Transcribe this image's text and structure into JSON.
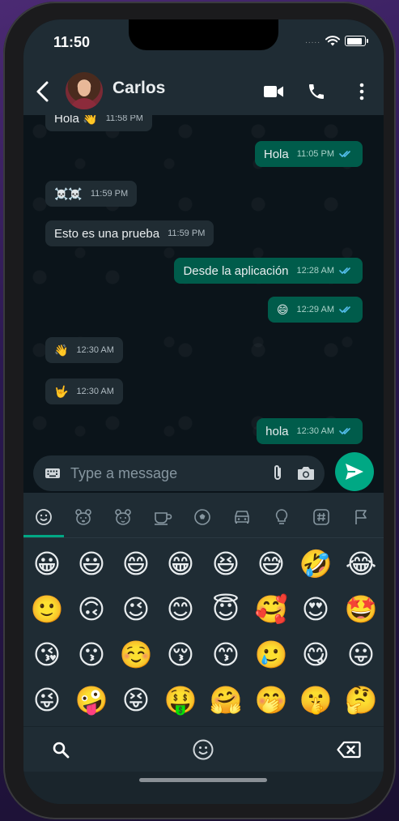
{
  "status_bar": {
    "time": "11:50",
    "signal_dots": "....."
  },
  "header": {
    "contact_name": "Carlos"
  },
  "messages": [
    {
      "dir": "in",
      "text": "Hola 👋",
      "time": "11:58 PM"
    },
    {
      "dir": "out",
      "text": "Hola",
      "time": "11:05 PM",
      "read": true
    },
    {
      "dir": "in",
      "text": "☠️☠️",
      "time": "11:59 PM",
      "emoji": true
    },
    {
      "dir": "in",
      "text": "Esto es una prueba",
      "time": "11:59 PM"
    },
    {
      "dir": "out",
      "text": "Desde la aplicación",
      "time": "12:28 AM",
      "read": true
    },
    {
      "dir": "out",
      "text": "😄",
      "time": "12:29 AM",
      "read": true,
      "emoji": true
    },
    {
      "dir": "in",
      "text": "👋",
      "time": "12:30 AM",
      "emoji": true
    },
    {
      "dir": "in",
      "text": "🤟",
      "time": "12:30 AM",
      "emoji": true
    },
    {
      "dir": "out",
      "text": "hola",
      "time": "12:30 AM",
      "read": true
    }
  ],
  "composer": {
    "placeholder": "Type a message"
  },
  "emoji_keyboard": {
    "categories": [
      "smileys-icon",
      "animals-icon",
      "animals-alt-icon",
      "food-icon",
      "activity-icon",
      "travel-icon",
      "objects-icon",
      "symbols-icon",
      "flags-icon"
    ],
    "active_category": 0,
    "rows": [
      [
        "😀",
        "😃",
        "😄",
        "😁",
        "😆",
        "😅",
        "🤣",
        "😂"
      ],
      [
        "🙂",
        "🙃",
        "😉",
        "😊",
        "😇",
        "🥰",
        "😍",
        "🤩"
      ],
      [
        "😘",
        "😗",
        "☺️",
        "😚",
        "😙",
        "🥲",
        "😋",
        "😛"
      ],
      [
        "😜",
        "🤪",
        "😝",
        "🤑",
        "🤗",
        "🤭",
        "🤫",
        "🤔"
      ]
    ]
  },
  "colors": {
    "header_bg": "#1f2c34",
    "chat_bg": "#0b141a",
    "bubble_in": "#202c33",
    "bubble_out": "#005c4b",
    "accent": "#00a884",
    "read_ticks": "#53bdeb"
  }
}
